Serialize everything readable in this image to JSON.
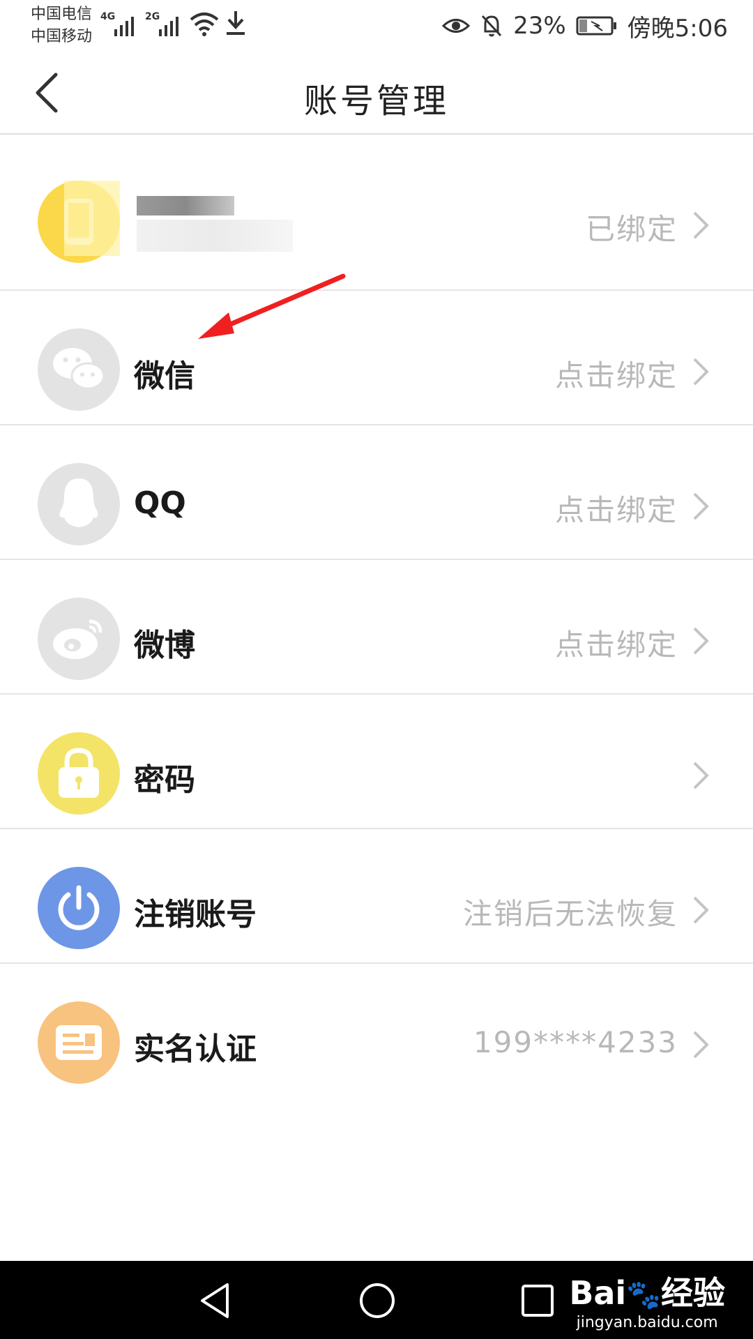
{
  "status_bar": {
    "carrier1": "中国电信",
    "carrier2": "中国移动",
    "net1": "4G",
    "net2": "2G",
    "battery": "23%",
    "time": "傍晚5:06"
  },
  "header": {
    "title": "账号管理"
  },
  "rows": [
    {
      "label": "",
      "status": "已绑定",
      "icon": "phone-icon",
      "color": "#fbd84a"
    },
    {
      "label": "微信",
      "status": "点击绑定",
      "icon": "wechat-icon",
      "color": "#e3e3e3"
    },
    {
      "label": "QQ",
      "status": "点击绑定",
      "icon": "qq-icon",
      "color": "#e3e3e3"
    },
    {
      "label": "微博",
      "status": "点击绑定",
      "icon": "weibo-icon",
      "color": "#e3e3e3"
    },
    {
      "label": "密码",
      "status": "",
      "icon": "lock-icon",
      "color": "#f3e468"
    },
    {
      "label": "注销账号",
      "status": "注销后无法恢复",
      "icon": "power-icon",
      "color": "#6d96e6"
    },
    {
      "label": "实名认证",
      "status": "199****4233",
      "icon": "id-card-icon",
      "color": "#f8c27f"
    }
  ],
  "watermark": {
    "brand": "Bai",
    "brand2": "经验",
    "url": "jingyan.baidu.com"
  }
}
